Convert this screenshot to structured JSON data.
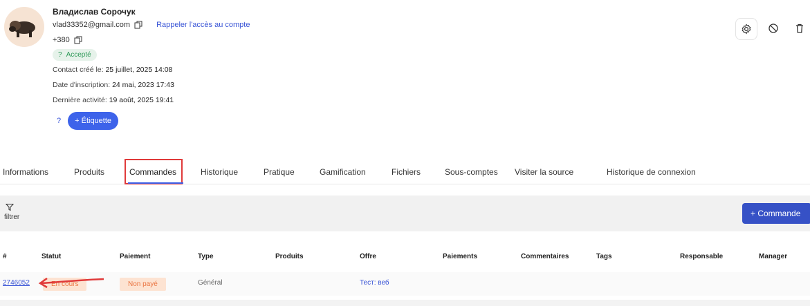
{
  "profile": {
    "name": "Владислав Сорочук",
    "email": "vlad33352@gmail.com",
    "remind_link": "Rappeler l'accès au compte",
    "phone": "+380",
    "status_badge": "Accepté",
    "status_badge_prefix": "?",
    "created_label": "Contact créé le:",
    "created_value": "25 juillet, 2025 14:08",
    "registered_label": "Date d'inscription:",
    "registered_value": "24 mai, 2023 17:43",
    "last_activity_label": "Dernière activité:",
    "last_activity_value": "19 août, 2025 19:41",
    "tag_help": "?",
    "tag_button": "+ Étiquette"
  },
  "header_actions": [
    "gear-icon",
    "block-icon",
    "trash-icon"
  ],
  "tabs": [
    {
      "label": "Informations"
    },
    {
      "label": "Produits"
    },
    {
      "label": "Commandes",
      "active": true
    },
    {
      "label": "Historique"
    },
    {
      "label": "Pratique"
    },
    {
      "label": "Gamification"
    },
    {
      "label": "Fichiers"
    },
    {
      "label": "Sous-comptes"
    },
    {
      "label": "Visiter la source"
    },
    {
      "label": "Historique de connexion"
    }
  ],
  "filter": {
    "label": "filtrer"
  },
  "new_order_button": "+ Commande",
  "table": {
    "columns": [
      "#",
      "Statut",
      "Paiement",
      "Type",
      "Produits",
      "Offre",
      "Paiements",
      "Commentaires",
      "Tags",
      "Responsable",
      "Manager"
    ],
    "rows": [
      {
        "id": "2746052",
        "status": "En cours",
        "payment": "Non payé",
        "type": "Général",
        "products": "",
        "offer": "Тест: веб",
        "payments": "",
        "comments": "",
        "tags": "",
        "responsible": "",
        "manager": ""
      }
    ]
  },
  "colors": {
    "accent": "#3d63ea",
    "button_dark": "#3651c6",
    "status_orange": "#ea7440",
    "status_bg": "#fde3d2",
    "annotation_red": "#e03a3a"
  }
}
